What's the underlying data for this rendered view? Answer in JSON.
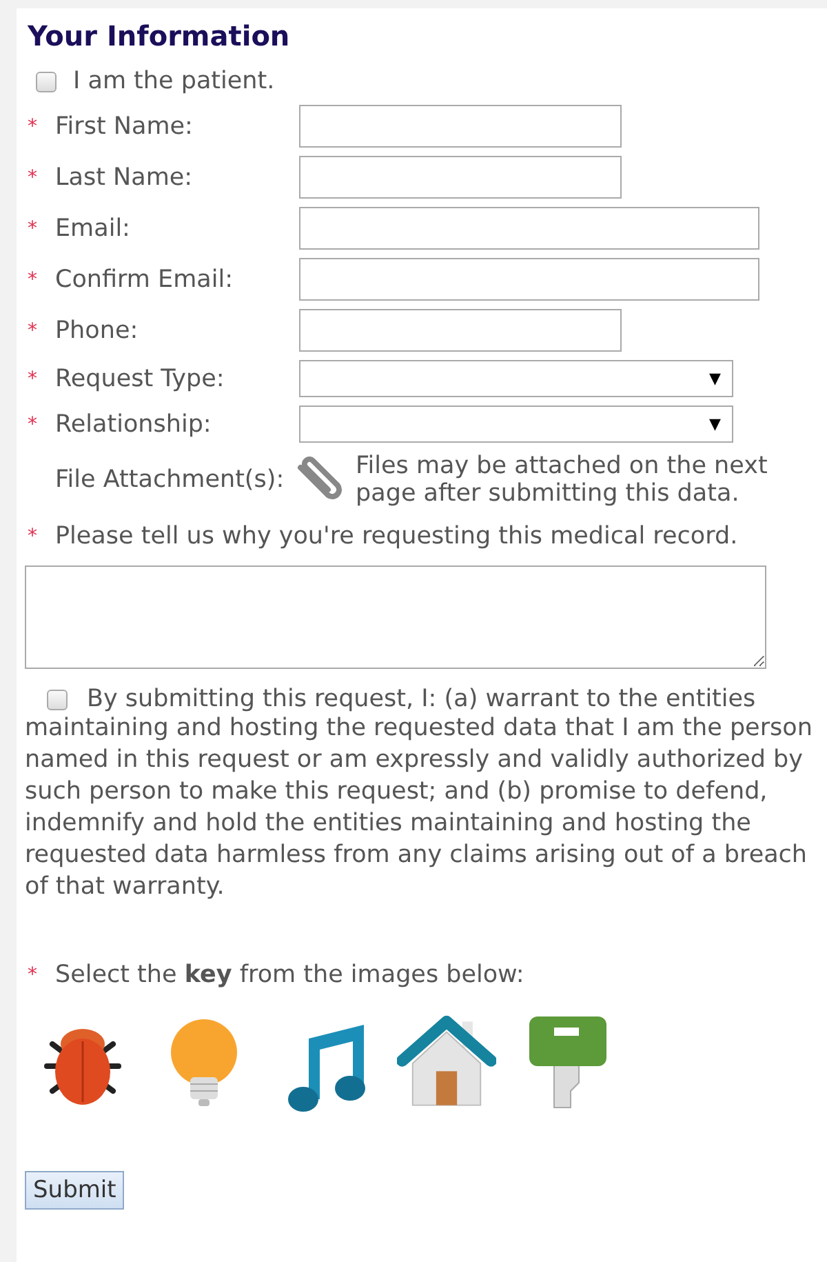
{
  "title": "Your Information",
  "required_mark": "*",
  "patient_checkbox": {
    "label": "I am the patient.",
    "checked": false
  },
  "fields": [
    {
      "label": "First Name:",
      "kind": "text",
      "required": true
    },
    {
      "label": "Last Name:",
      "kind": "text",
      "required": true
    },
    {
      "label": "Email:",
      "kind": "email",
      "required": true
    },
    {
      "label": "Confirm Email:",
      "kind": "email",
      "required": true
    },
    {
      "label": "Phone:",
      "kind": "text",
      "required": true
    },
    {
      "label": "Request Type:",
      "kind": "select",
      "arrow": "▼",
      "required": true
    },
    {
      "label": "Relationship:",
      "kind": "select",
      "arrow": "▼",
      "required": true
    }
  ],
  "attachment": {
    "label": "File Attachment(s):",
    "note": "Files may be attached on the next page after submitting this data."
  },
  "reason": {
    "label": "Please tell us why you're requesting this medical record.",
    "required": true
  },
  "consent": {
    "checked": false,
    "first_line": "By submitting this request, I: (a) warrant to the entities",
    "text": "maintaining and hosting the requested data that I am the person named in this request or am expressly and validly authorized by such person to make this request; and (b) promise to defend, indemnify and hold the entities maintaining and hosting the requested data harmless from any claims arising out of a breach of that warranty."
  },
  "captcha": {
    "label": "Select the **key** from the images below:",
    "required": true,
    "images": [
      {
        "kind": "bug",
        "selected": false
      },
      {
        "kind": "bulb",
        "selected": false
      },
      {
        "kind": "note",
        "selected": false
      },
      {
        "kind": "house",
        "selected": false
      },
      {
        "kind": "key",
        "selected": false
      }
    ]
  },
  "submit": "Submit"
}
